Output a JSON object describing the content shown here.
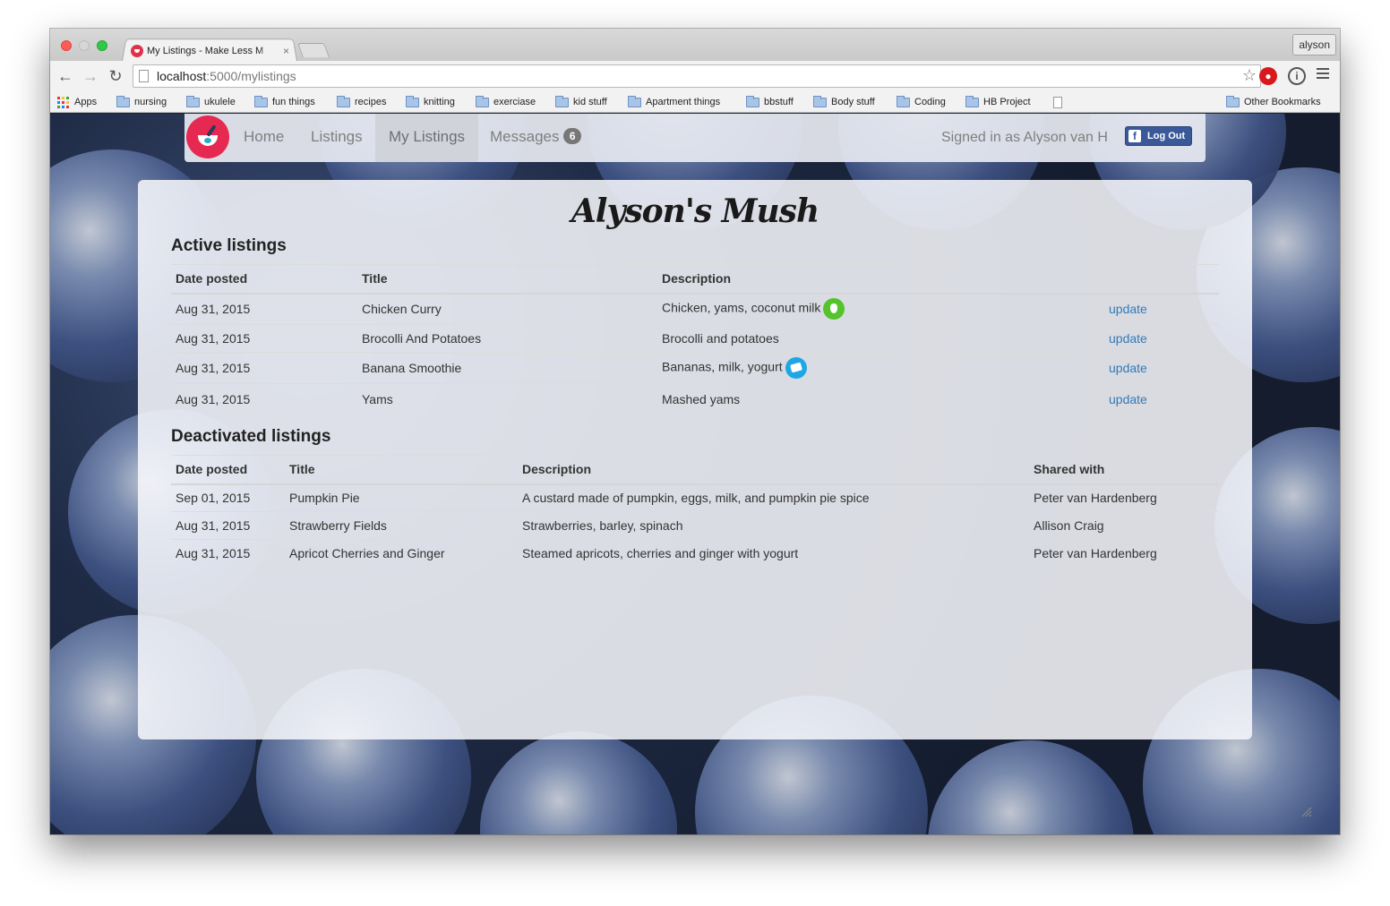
{
  "browser": {
    "tab_title": "My Listings - Make Less M",
    "tab_close": "×",
    "profile_name": "alyson",
    "url_host": "localhost",
    "url_path": ":5000/mylistings",
    "nav": {
      "back": "←",
      "forward": "→",
      "reload": "↻",
      "star": "☆",
      "ext_info": "i"
    },
    "bookmarks": [
      "Apps",
      "nursing",
      "ukulele",
      "fun things",
      "recipes",
      "knitting",
      "exerciase",
      "kid stuff",
      "Apartment things",
      "bbstuff",
      "Body stuff",
      "Coding",
      "HB Project"
    ],
    "other_bookmarks": "Other Bookmarks"
  },
  "navbar": {
    "links": [
      "Home",
      "Listings",
      "My Listings",
      "Messages"
    ],
    "messages_count": "6",
    "signed_in": "Signed in as Alyson van H",
    "logout": "Log Out",
    "fb_letter": "f"
  },
  "page": {
    "title": "Alyson's Mush",
    "active_heading": "Active listings",
    "active_headers": [
      "Date posted",
      "Title",
      "Description",
      ""
    ],
    "active_rows": [
      {
        "date": "Aug 31, 2015",
        "title": "Chicken Curry",
        "description": "Chicken, yams, coconut milk",
        "action": "update",
        "icon": "vegetable-tag-icon"
      },
      {
        "date": "Aug 31, 2015",
        "title": "Brocolli And Potatoes",
        "description": "Brocolli and potatoes",
        "action": "update",
        "icon": ""
      },
      {
        "date": "Aug 31, 2015",
        "title": "Banana Smoothie",
        "description": "Bananas, milk, yogurt",
        "action": "update",
        "icon": "dairy-tag-icon"
      },
      {
        "date": "Aug 31, 2015",
        "title": "Yams",
        "description": "Mashed yams",
        "action": "update",
        "icon": ""
      }
    ],
    "deactivated_heading": "Deactivated listings",
    "deactivated_headers": [
      "Date posted",
      "Title",
      "Description",
      "Shared with"
    ],
    "deactivated_rows": [
      {
        "date": "Sep 01, 2015",
        "title": "Pumpkin Pie",
        "description": "A custard made of pumpkin, eggs, milk, and pumpkin pie spice",
        "shared": "Peter van Hardenberg"
      },
      {
        "date": "Aug 31, 2015",
        "title": "Strawberry Fields",
        "description": "Strawberries, barley, spinach",
        "shared": "Allison Craig"
      },
      {
        "date": "Aug 31, 2015",
        "title": "Apricot Cherries and Ginger",
        "description": "Steamed apricots, cherries and ginger with yogurt",
        "shared": "Peter van Hardenberg"
      }
    ]
  },
  "colors": {
    "link": "#337ab7",
    "logo": "#e62950",
    "facebook": "#3b5998"
  }
}
